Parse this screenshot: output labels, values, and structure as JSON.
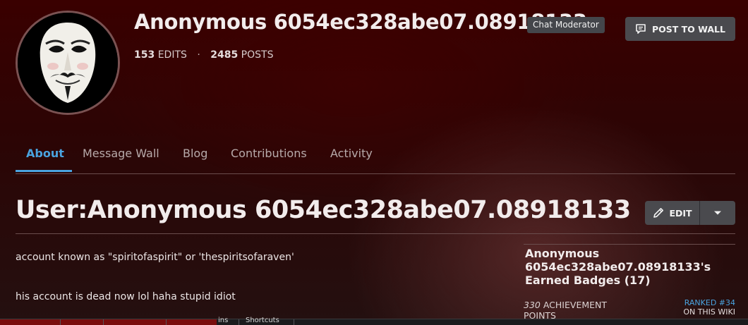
{
  "profile": {
    "username": "Anonymous 6054ec328abe07.08918133",
    "role_tag": "Chat Moderator",
    "edits_count": "153",
    "edits_label": "EDITS",
    "separator": "·",
    "posts_count": "2485",
    "posts_label": "POSTS",
    "post_button_label": "POST TO WALL",
    "avatar_icon": "guy-fawkes-mask-icon"
  },
  "tabs": [
    {
      "label": "About",
      "active": true
    },
    {
      "label": "Message Wall",
      "active": false
    },
    {
      "label": "Blog",
      "active": false
    },
    {
      "label": "Contributions",
      "active": false
    },
    {
      "label": "Activity",
      "active": false
    }
  ],
  "page": {
    "title": "User:Anonymous 6054ec328abe07.08918133",
    "edit_label": "EDIT",
    "paragraphs": [
      "account known as \"spiritofaspirit\" or 'thespiritsofaraven'",
      "his account is dead now lol haha stupid idiot"
    ]
  },
  "sidebar": {
    "badges_heading": "Anonymous 6054ec328abe07.08918133's Earned Badges (17)",
    "achievement_points_value": "330",
    "achievement_points_label": "ACHIEVEMENT POINTS",
    "ranked_label": "RANKED #34",
    "ranked_sub": "ON THIS WIKI"
  },
  "bottom_toolbar": {
    "partial_label": "ins",
    "shortcuts_label": "Shortcuts"
  },
  "colors": {
    "accent": "#4aa3df",
    "button_bg": "#4a4a4e",
    "tag_bg": "#44464b"
  }
}
